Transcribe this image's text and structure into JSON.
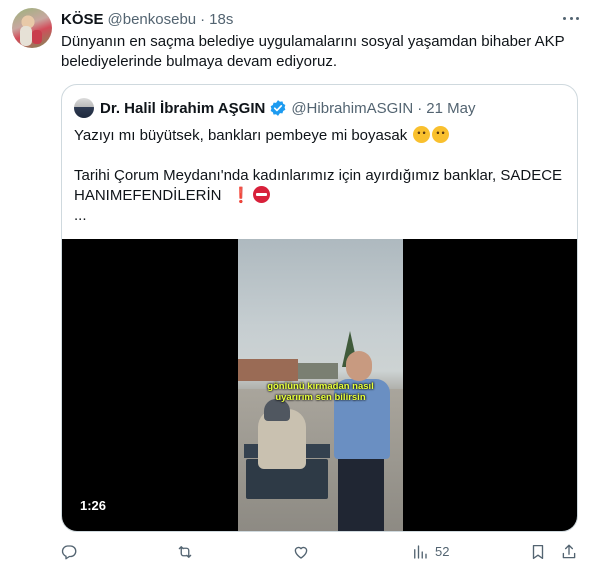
{
  "tweet": {
    "author_name": "KÖSE",
    "author_handle": "@benkosebu",
    "separator": "·",
    "time": "18s",
    "text": "Dünyanın en saçma belediye uygulamalarını sosyal yaşamdan bihaber AKP belediyelerinde bulmaya devam ediyoruz."
  },
  "quote": {
    "author_name": "Dr. Halil İbrahim AŞGIN",
    "author_handle": "@HibrahimASGIN",
    "separator": "·",
    "time": "21 May",
    "verified": true,
    "line1": "Yazıyı mı büyütsek, bankları pembeye mi boyasak",
    "line2": "Tarihi Çorum Meydanı'nda kadınlarımız için ayırdığımız banklar, SADECE",
    "line3": "HANIMEFENDİLERİN",
    "line3_mark": "❗",
    "ellipsis": "...",
    "video": {
      "duration": "1:26",
      "subtitle_line1": "gönlünü kırmadan nasıl",
      "subtitle_line2": "uyarırım sen bilirsin"
    }
  },
  "actions": {
    "views": "52",
    "icons": [
      "reply-icon",
      "retweet-icon",
      "like-icon",
      "views-icon",
      "bookmark-icon",
      "share-icon"
    ]
  },
  "colors": {
    "text": "#0f1419",
    "secondary": "#536471",
    "border": "#cfd9de",
    "verified": "#1d9bf0",
    "subtitle": "#e7ff3a"
  }
}
